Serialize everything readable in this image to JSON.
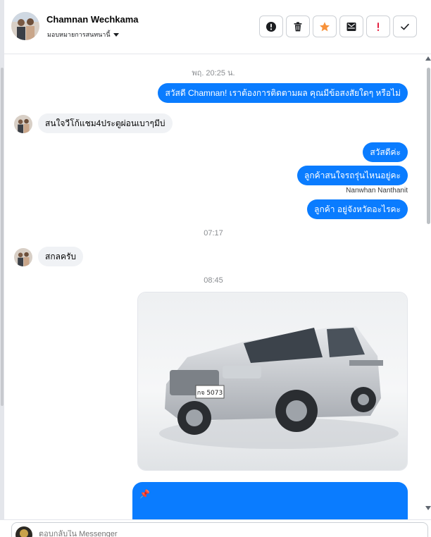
{
  "header": {
    "contact_name": "Chamnan Wechkama",
    "assign_label": "มอบหมายการสนทนานี้",
    "tools": [
      {
        "icon": "info-icon"
      },
      {
        "icon": "trash-icon"
      },
      {
        "icon": "star-icon"
      },
      {
        "icon": "move-to-inbox-icon"
      },
      {
        "icon": "spam-icon"
      },
      {
        "icon": "check-icon"
      }
    ]
  },
  "thread": {
    "timestamps": [
      "พฤ. 20:25 น.",
      "07:17",
      "08:45"
    ],
    "messages": [
      {
        "direction": "outgoing",
        "text": "สวัสดี Chamnan! เราต้องการติดตามผล คุณมีข้อสงสัยใดๆ หรือไม่"
      },
      {
        "direction": "incoming",
        "text": "สนใจวีโก้แชม4ประตูผ่อนเบาๆมีบ่"
      },
      {
        "direction": "outgoing",
        "text": "สวัสดีค่ะ"
      },
      {
        "direction": "outgoing",
        "text": "ลูกค้าสนใจรถรุ่นไหนอยู่คะ"
      },
      {
        "direction": "outgoing",
        "text": "ลูกค้า อยู่จังหวัดอะไรคะ"
      },
      {
        "direction": "incoming",
        "text": "สกลครับ"
      }
    ],
    "sender_label": "Nanwhan Nanthanit",
    "photo": {
      "subject": "silver pickup truck",
      "plate": "กจ 5073"
    },
    "last_message_icon": "📌"
  },
  "composer": {
    "placeholder": "ตอบกลับใน Messenger"
  },
  "colors": {
    "outgoing_bubble": "#0a7cff",
    "incoming_bubble": "#f0f2f5",
    "star": "#f7923a",
    "spam": "#e41e3f"
  }
}
